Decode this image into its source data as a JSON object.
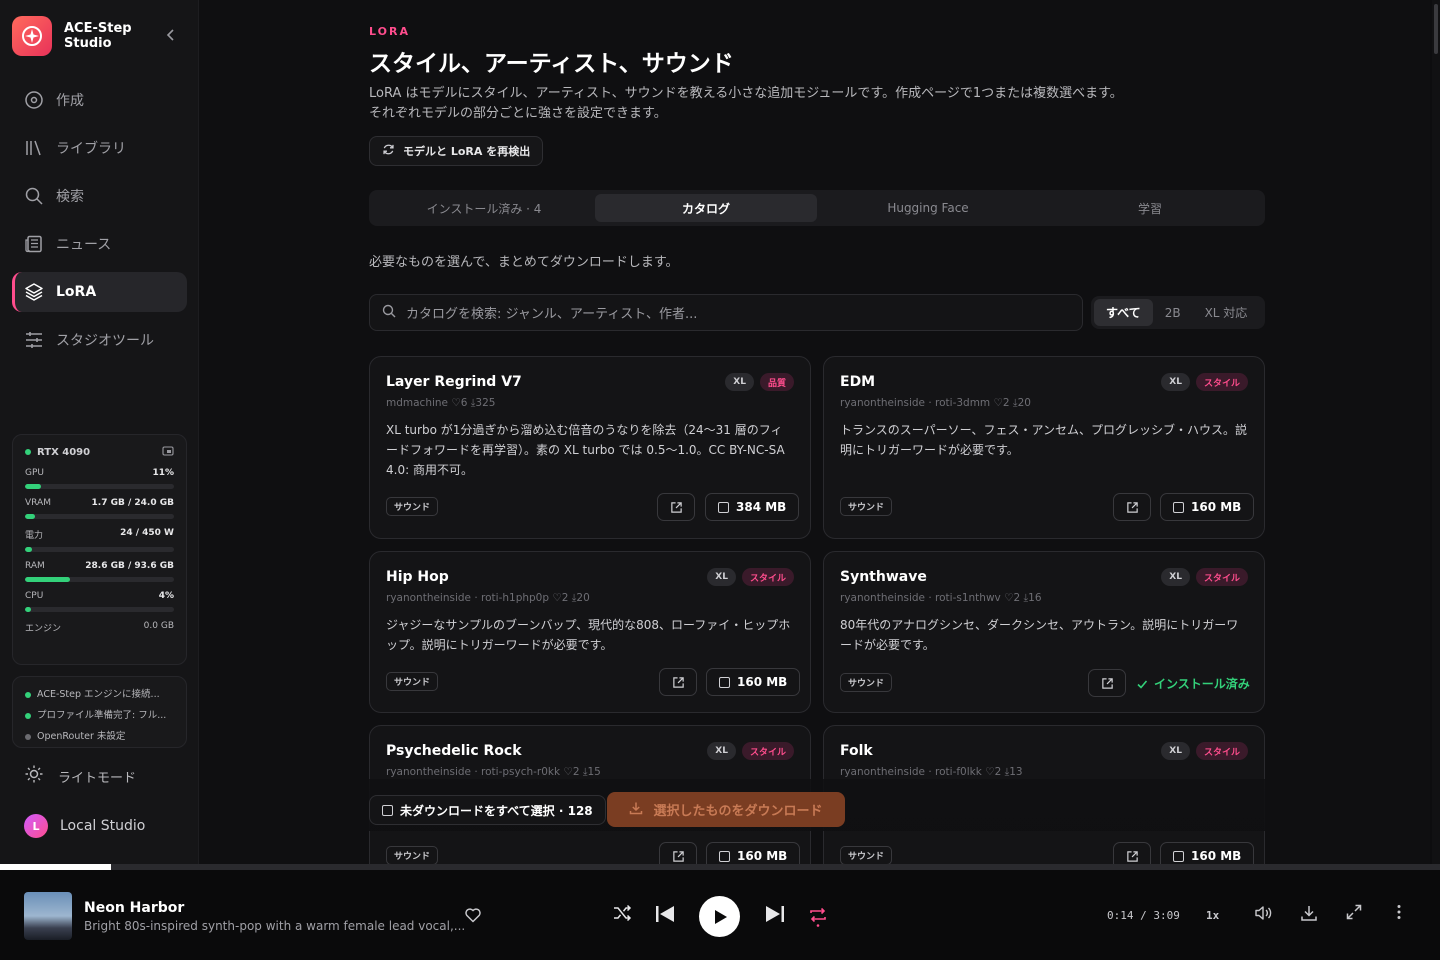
{
  "brand": {
    "name": "ACE-Step Studio"
  },
  "nav": [
    {
      "label": "作成",
      "icon": "disc-icon"
    },
    {
      "label": "ライブラリ",
      "icon": "library-icon"
    },
    {
      "label": "検索",
      "icon": "search-icon"
    },
    {
      "label": "ニュース",
      "icon": "newspaper-icon"
    },
    {
      "label": "LoRA",
      "icon": "layers-icon",
      "active": true
    },
    {
      "label": "スタジオツール",
      "icon": "sliders-icon"
    }
  ],
  "gpu": {
    "name": "RTX 4090",
    "metrics": [
      {
        "label": "GPU",
        "value": "11%",
        "fill": 0.11
      },
      {
        "label": "VRAM",
        "value": "1.7 GB / 24.0 GB",
        "fill": 0.07
      },
      {
        "label": "電力",
        "value": "24 / 450 W",
        "fill": 0.05
      },
      {
        "label": "RAM",
        "value": "28.6 GB / 93.6 GB",
        "fill": 0.3
      },
      {
        "label": "CPU",
        "value": "4%",
        "fill": 0.04
      }
    ],
    "engine_label": "エンジン",
    "engine_value": "0.0 GB"
  },
  "status": [
    {
      "text": "ACE-Step エンジンに接続...",
      "color": "#33d17a"
    },
    {
      "text": "プロファイル準備完了: フル...",
      "color": "#33d17a"
    },
    {
      "text": "OpenRouter 未設定",
      "color": "#6b6b70"
    }
  ],
  "theme_label": "ライトモード",
  "profile": {
    "initial": "L",
    "name": "Local Studio"
  },
  "page": {
    "eyebrow": "LORA",
    "title": "スタイル、アーティスト、サウンド",
    "description": "LoRA はモデルにスタイル、アーティスト、サウンドを教える小さな追加モジュールです。作成ページで1つまたは複数選べます。それぞれモデルの部分ごとに強さを設定できます。",
    "rescan_label": "モデルと LoRA を再検出",
    "tabs": [
      "インストール済み · 4",
      "カタログ",
      "Hugging Face",
      "学習"
    ],
    "active_tab": 1,
    "hint": "必要なものを選んで、まとめてダウンロードします。",
    "search_placeholder": "カタログを検索: ジャンル、アーティスト、作者...",
    "filters": [
      "すべて",
      "2B",
      "XL 対応"
    ],
    "active_filter": 0
  },
  "cards": [
    {
      "name": "Layer Regrind V7",
      "meta": "mdmachine  ♡6  ⤓325",
      "badges": [
        "XL",
        "品質"
      ],
      "body": "XL turbo が1分過ぎから溜め込む倍音のうなりを除去（24〜31 層のフィードフォワードを再学習）。素の XL turbo では 0.5〜1.0。CC BY-NC-SA 4.0: 商用不可。",
      "tag": "サウンド",
      "size": "384 MB"
    },
    {
      "name": "EDM",
      "meta": "ryanontheinside · roti-3dmm  ♡2  ⤓20",
      "badges": [
        "XL",
        "スタイル"
      ],
      "body": "トランスのスーパーソー、フェス・アンセム、プログレッシブ・ハウス。説明にトリガーワードが必要です。",
      "tag": "サウンド",
      "size": "160 MB"
    },
    {
      "name": "Hip Hop",
      "meta": "ryanontheinside · roti-h1php0p  ♡2  ⤓20",
      "badges": [
        "XL",
        "スタイル"
      ],
      "body": "ジャジーなサンプルのブーンバップ、現代的な808、ローファイ・ヒップホップ。説明にトリガーワードが必要です。",
      "tag": "サウンド",
      "size": "160 MB"
    },
    {
      "name": "Synthwave",
      "meta": "ryanontheinside · roti-s1nthwv  ♡2  ⤓16",
      "badges": [
        "XL",
        "スタイル"
      ],
      "body": "80年代のアナログシンセ、ダークシンセ、アウトラン。説明にトリガーワードが必要です。",
      "tag": "サウンド",
      "installed": "インストール済み"
    },
    {
      "name": "Psychedelic Rock",
      "meta": "ryanontheinside · roti-psych-r0kk  ♡2  ⤓15",
      "badges": [
        "XL",
        "スタイル"
      ],
      "tag": "サウンド",
      "size": "160 MB"
    },
    {
      "name": "Folk",
      "meta": "ryanontheinside · roti-f0lkk  ♡2  ⤓13",
      "badges": [
        "XL",
        "スタイル"
      ],
      "tag": "サウンド",
      "size": "160 MB"
    }
  ],
  "actions": {
    "select_all": "未ダウンロードをすべて選択 · 128",
    "download_selected": "選択したものをダウンロード"
  },
  "player": {
    "title": "Neon Harbor",
    "subtitle": "Bright 80s-inspired synth-pop with a warm female lead vocal,...",
    "time": "0:14 / 3:09",
    "speed": "1x",
    "progress": 0.077
  }
}
